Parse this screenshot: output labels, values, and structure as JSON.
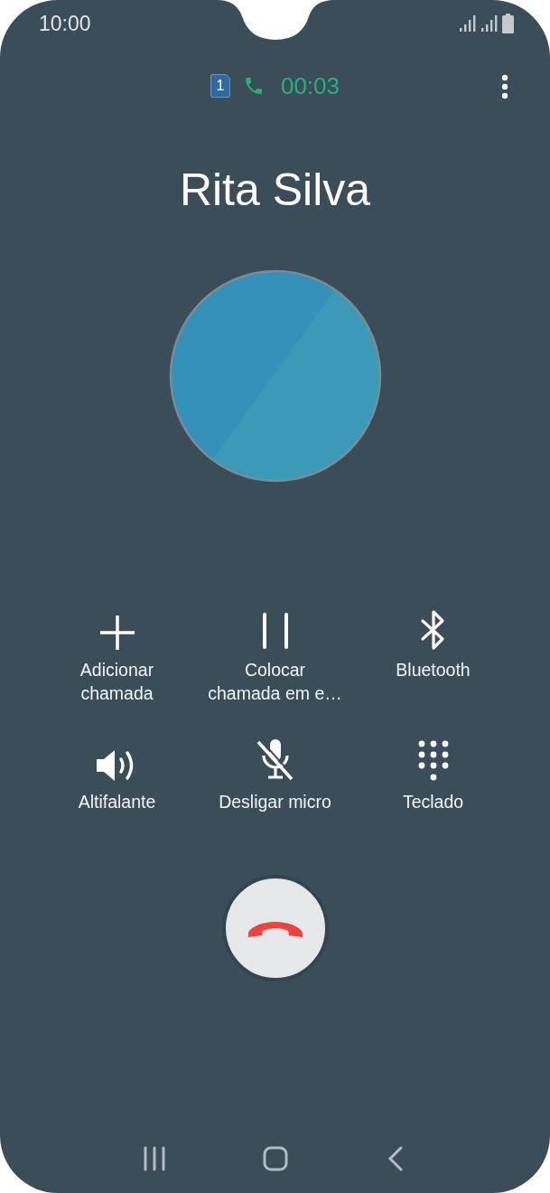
{
  "status_bar": {
    "time": "10:00"
  },
  "call_info": {
    "sim": "1",
    "timer": "00:03"
  },
  "contact": {
    "name": "Rita Silva"
  },
  "controls": [
    {
      "kind": "add",
      "label": "Adicionar\nchamada"
    },
    {
      "kind": "hold",
      "label": "Colocar\nchamada em e…"
    },
    {
      "kind": "bluetooth",
      "label": "Bluetooth"
    },
    {
      "kind": "speaker",
      "label": "Altifalante"
    },
    {
      "kind": "mute",
      "label": "Desligar micro"
    },
    {
      "kind": "keypad",
      "label": "Teclado"
    }
  ]
}
